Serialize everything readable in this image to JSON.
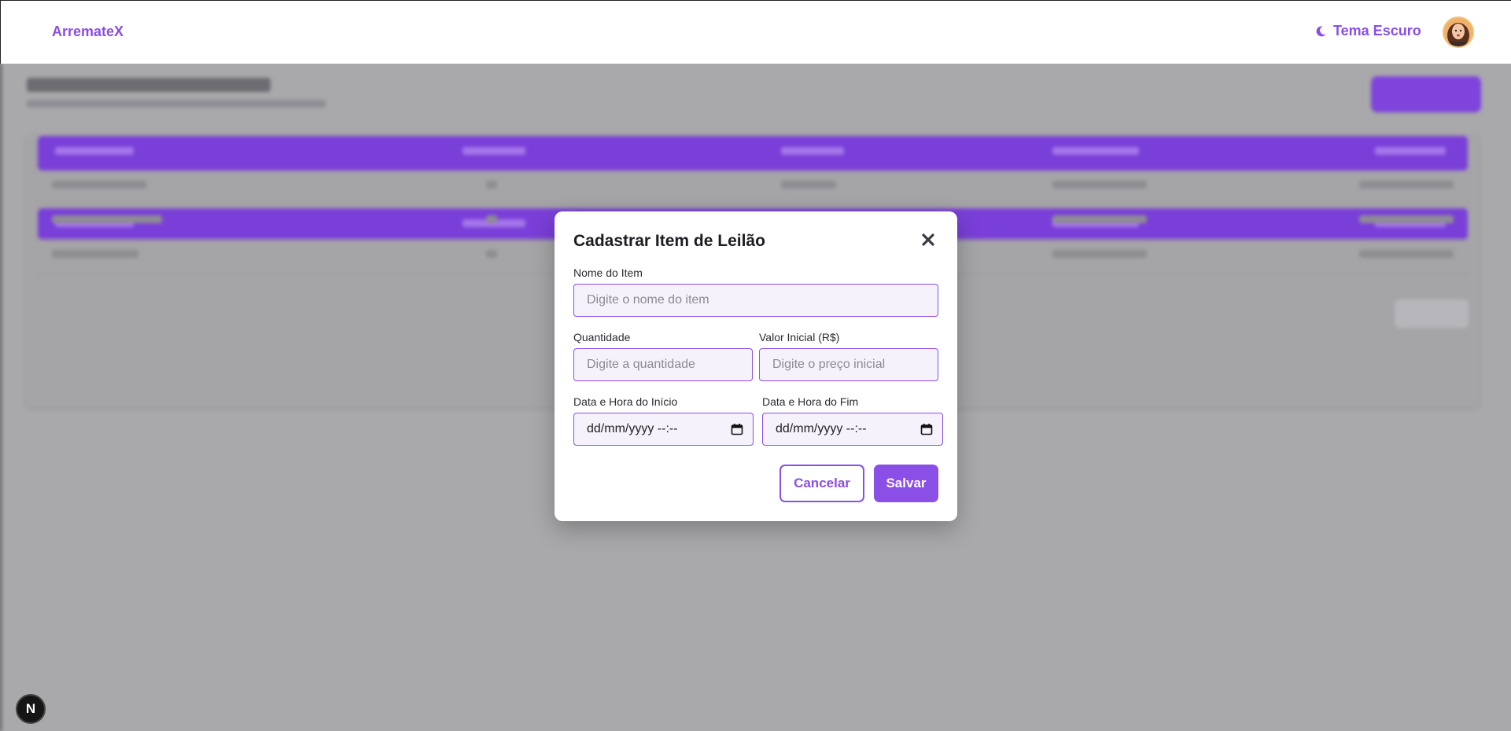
{
  "header": {
    "brand": "ArremateX",
    "theme_toggle_label": "Tema Escuro"
  },
  "modal": {
    "title": "Cadastrar Item de Leilão",
    "fields": {
      "name_label": "Nome do Item",
      "name_placeholder": "Digite o nome do item",
      "quantity_label": "Quantidade",
      "quantity_placeholder": "Digite a quantidade",
      "price_label": "Valor Inicial (R$)",
      "price_placeholder": "Digite o preço inicial",
      "start_label": "Data e Hora do Início",
      "start_value": "dd/mm/yyyy --:--",
      "end_label": "Data e Hora do Fim",
      "end_value": "dd/mm/yyyy --:--"
    },
    "cancel_label": "Cancelar",
    "save_label": "Salvar"
  },
  "next_badge": "N",
  "colors": {
    "accent": "#8a4fe6",
    "table_header": "#7a3fd8",
    "backdrop": "#a9a8ab"
  }
}
